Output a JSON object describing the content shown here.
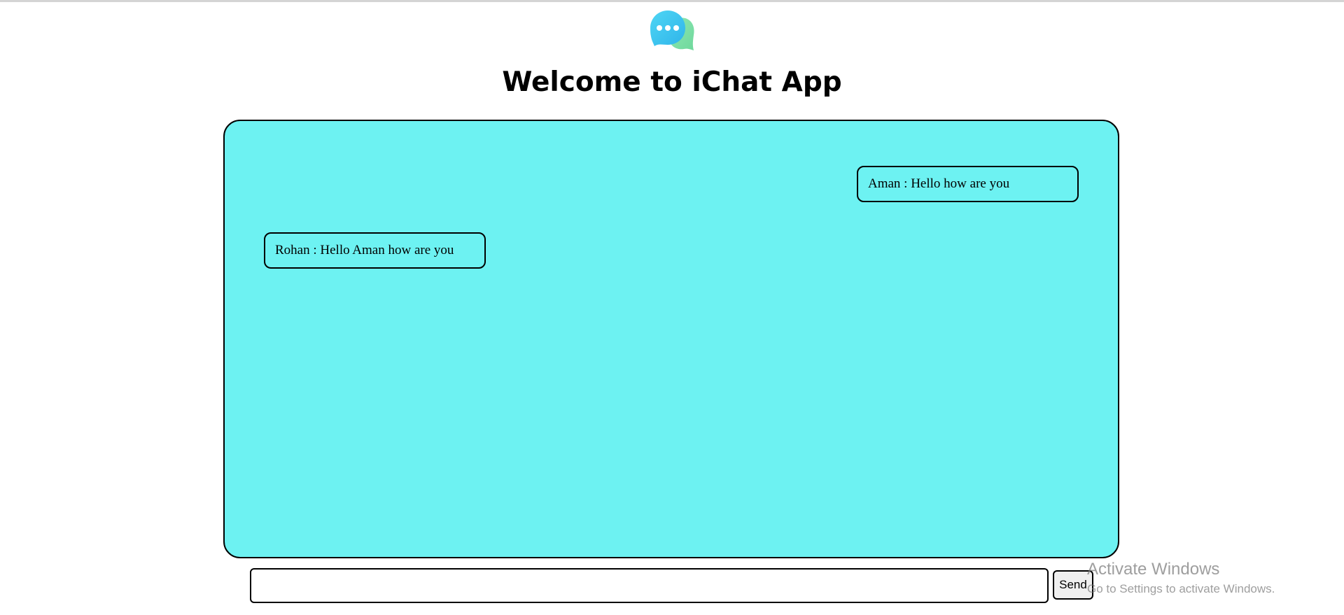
{
  "header": {
    "logo_icon": "chat-bubbles-icon",
    "title": "Welcome to iChat App"
  },
  "colors": {
    "chat_background": "#6df2f2",
    "logo_bubble_front": "#38c6ef",
    "logo_bubble_back": "#7fe0a6"
  },
  "chat": {
    "messages": [
      {
        "position": "right",
        "text": "Aman : Hello how are you"
      },
      {
        "position": "left",
        "text": "Rohan : Hello Aman how are you"
      }
    ]
  },
  "composer": {
    "input_value": "",
    "input_placeholder": "",
    "send_label": "Send"
  },
  "watermark": {
    "title": "Activate Windows",
    "subtitle": "Go to Settings to activate Windows."
  }
}
